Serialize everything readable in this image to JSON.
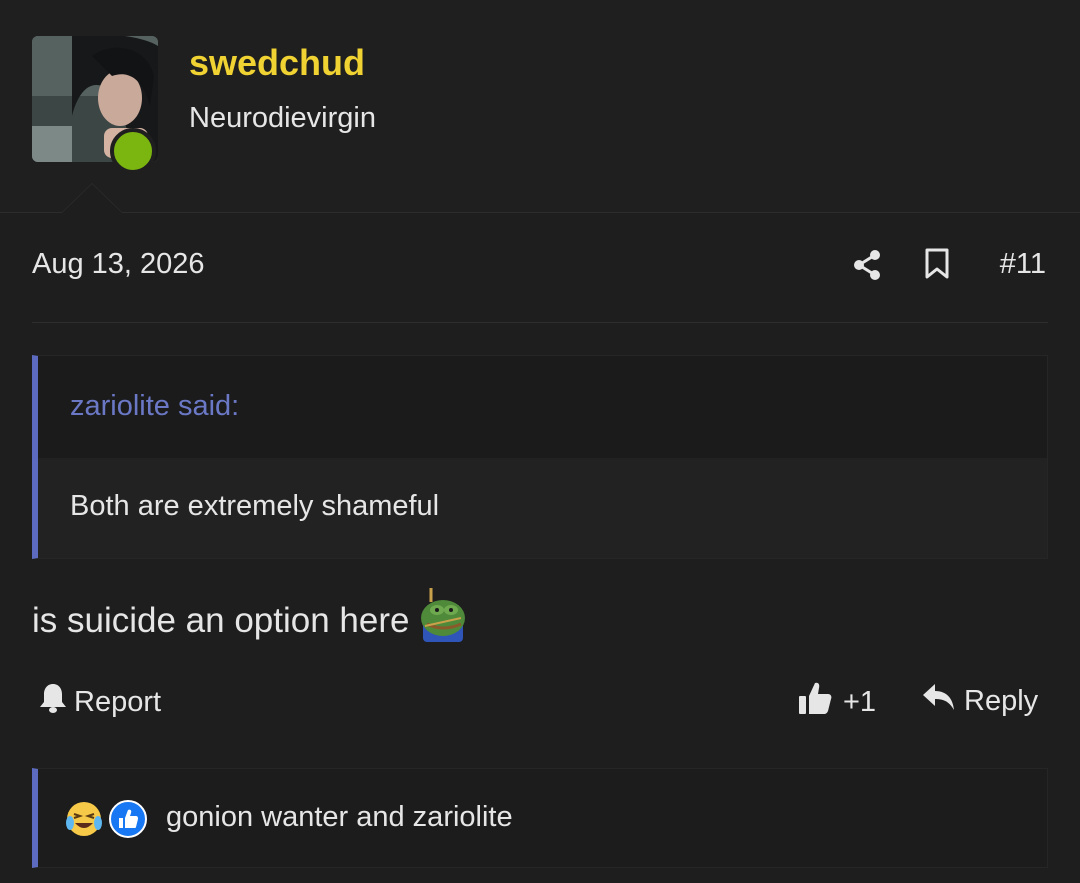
{
  "user": {
    "username": "swedchud",
    "title": "Neurodievirgin",
    "online": true
  },
  "post": {
    "date": "Aug 13, 2026",
    "number": "#11",
    "icons": [
      "share-icon",
      "bookmark-icon"
    ]
  },
  "quote": {
    "author": "zariolite said:",
    "text": "Both are extremely shameful"
  },
  "message": {
    "text": "is suicide an option here",
    "emoji": "pepe-hanging-emoji"
  },
  "actions": {
    "report": "Report",
    "like_count": "+1",
    "reply": "Reply"
  },
  "reactions": {
    "icons": [
      "laughing-crying-emoji",
      "thumbs-up-reaction"
    ],
    "text": "gonion wanter and zariolite"
  },
  "colors": {
    "background": "#1e1e1e",
    "username": "#f0d232",
    "accent": "#5c6bc0",
    "quote_author": "#6b78c6",
    "online": "#7bb510"
  }
}
